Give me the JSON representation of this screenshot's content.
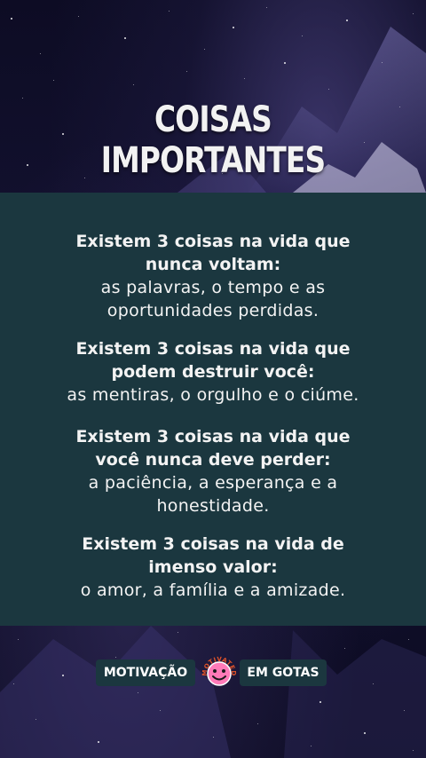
{
  "title": "COISAS IMPORTANTES",
  "sections": [
    {
      "heading": [
        "Existem 3 coisas na vida que",
        "nunca voltam:"
      ],
      "body": [
        "as palavras, o tempo e as",
        "oportunidades perdidas."
      ]
    },
    {
      "heading": [
        "Existem 3 coisas na vida que",
        "podem destruir você:"
      ],
      "body": [
        "as mentiras, o orgulho e o ciúme."
      ]
    },
    {
      "heading": [
        "Existem 3 coisas na vida que",
        "você nunca deve perder:"
      ],
      "body": [
        "a paciência, a esperança e a",
        "honestidade."
      ]
    },
    {
      "heading": [
        "Existem 3 coisas na vida de",
        "imenso valor:"
      ],
      "body": [
        "o amor, a família e a amizade."
      ]
    }
  ],
  "brand": {
    "left": "MOTIVAÇÃO",
    "right": "EM GOTAS",
    "logo_text": "MOTIVATED",
    "logo_icon": "smiley-face-icon"
  },
  "colors": {
    "panel": "#1b373f",
    "background": "#0d0c24",
    "logo_face": "#ff7ab8",
    "logo_ring": "#e2532a"
  }
}
